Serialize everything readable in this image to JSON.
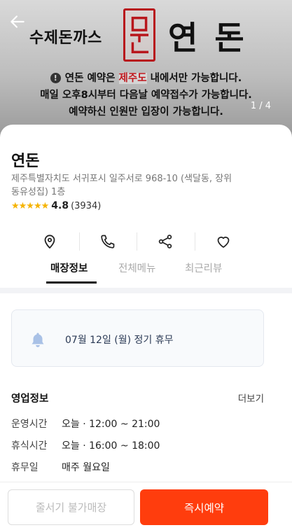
{
  "hero": {
    "brand_left": "수제돈까스",
    "seal_text": "연돈",
    "brand_right": "연 돈",
    "notice_line1_pre": "연돈 예약은 ",
    "notice_line1_highlight": "제주도",
    "notice_line1_post": " 내에서만 가능합니다.",
    "notice_line2": "매일 오후8시부터 다음날 예약접수가 가능합니다.",
    "notice_line3": "예약하신 인원만 입장이 가능합니다.",
    "warn_symbol": "!",
    "page_indicator": "1 / 4",
    "icons": {
      "back": "back-arrow-icon",
      "warning": "warning-icon"
    }
  },
  "store": {
    "name": "연돈",
    "address": "제주특별자치도 서귀포시 일주서로 968-10 (색달동, 장위동유성집) 1층",
    "stars": "★★★★★",
    "rating": "4.8",
    "review_count": "(3934)"
  },
  "actions": [
    {
      "name": "location",
      "icon": "location-pin-icon"
    },
    {
      "name": "call",
      "icon": "phone-icon"
    },
    {
      "name": "share",
      "icon": "share-icon"
    },
    {
      "name": "favorite",
      "icon": "heart-icon"
    }
  ],
  "tabs": [
    "매장정보",
    "전체메뉴",
    "최근리뷰"
  ],
  "holiday": {
    "icon": "bell-icon",
    "text": "07월 12일 (월) 정기 휴무"
  },
  "business": {
    "title": "영업정보",
    "more": "더보기",
    "rows": [
      {
        "label": "운영시간",
        "value": "오늘 · 12:00 ~ 21:00"
      },
      {
        "label": "휴식시간",
        "value": "오늘 · 16:00 ~ 18:00"
      },
      {
        "label": "휴무일",
        "value": "매주 월요일"
      }
    ]
  },
  "bottom": {
    "queue_label": "줄서기 불가매장",
    "reserve_label": "즉시예약"
  },
  "colors": {
    "accent": "#ff3d0d",
    "star": "#f5b301",
    "seal": "#b8161c"
  }
}
